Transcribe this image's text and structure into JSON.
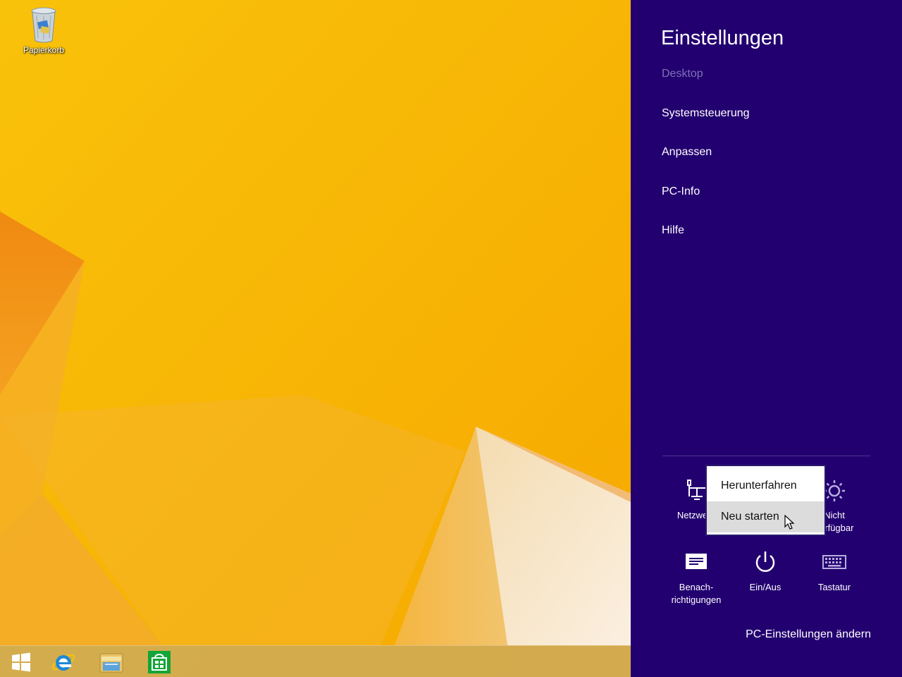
{
  "desktop": {
    "icons": [
      {
        "label": "Papierkorb",
        "icon": "recycle-bin-icon"
      }
    ]
  },
  "taskbar": {
    "items": [
      {
        "name": "start",
        "icon": "windows-logo-icon"
      },
      {
        "name": "internet-explorer",
        "icon": "internet-explorer-icon"
      },
      {
        "name": "file-explorer",
        "icon": "folder-icon"
      },
      {
        "name": "store",
        "icon": "store-bag-icon"
      }
    ]
  },
  "charm": {
    "title": "Einstellungen",
    "context": "Desktop",
    "items": [
      "Systemsteuerung",
      "Anpassen",
      "PC-Info",
      "Hilfe"
    ],
    "quick_settings": [
      {
        "label": "Netzwerk",
        "icon": "network-icon"
      },
      {
        "label": "Nicht verfügbar",
        "line1": "Nicht",
        "line2": "verfügbar",
        "icon": "brightness-icon"
      },
      {
        "label": "Benachrichtigungen",
        "line1": "Benach-",
        "line2": "richtigungen",
        "icon": "notifications-icon"
      },
      {
        "label": "Ein/Aus",
        "icon": "power-icon"
      },
      {
        "label": "Tastatur",
        "icon": "keyboard-icon"
      }
    ],
    "footer_link": "PC-Einstellungen ändern",
    "background_color": "#230070"
  },
  "power_menu": {
    "items": [
      "Herunterfahren",
      "Neu starten"
    ],
    "hovered": "Neu starten"
  }
}
